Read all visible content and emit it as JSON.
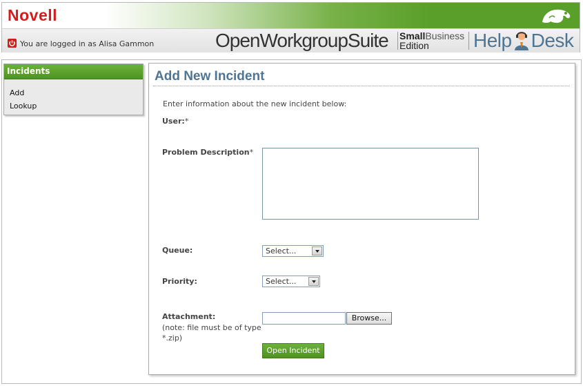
{
  "header": {
    "brand": "Novell",
    "logged_in_text": "You are logged in as Alisa Gammon",
    "suite_title": "OpenWorkgroupSuite",
    "edition_line1a": "Small",
    "edition_line1b": "Business",
    "edition_line2": "Edition",
    "helpdesk_part1": "Help",
    "helpdesk_part2": "Desk"
  },
  "sidebar": {
    "title": "Incidents",
    "items": [
      {
        "label": "Add"
      },
      {
        "label": "Lookup"
      }
    ]
  },
  "form": {
    "title": "Add New Incident",
    "intro": "Enter information about the new incident below:",
    "user_label": "User:",
    "problem_label": "Problem Description",
    "required_mark": "*",
    "problem_value": "",
    "queue_label": "Queue:",
    "queue_selected": "Select...",
    "priority_label": "Priority:",
    "priority_selected": "Select...",
    "attachment_label": "Attachment:",
    "attachment_note": "(note: file must be of type *.zip)",
    "browse_label": "Browse...",
    "submit_label": "Open Incident"
  },
  "colors": {
    "brand_red": "#d51b1b",
    "accent_green": "#5a9f2a",
    "title_blue": "#4f7594"
  }
}
